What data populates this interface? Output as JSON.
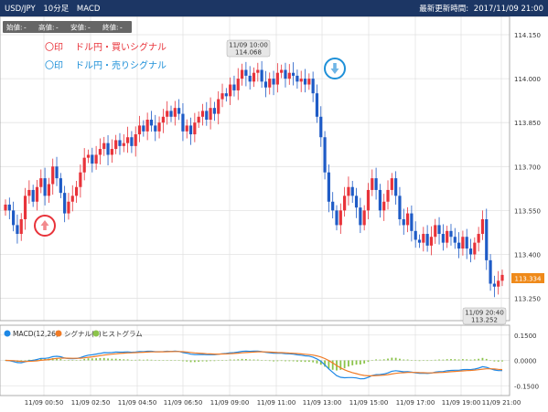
{
  "header": {
    "symbol": "USD/JPY",
    "interval": "10分足",
    "indicator": "MACD",
    "last_updated_label": "最新更新時間:",
    "last_updated_value": "2017/11/09 21:00"
  },
  "ohlc_bar": [
    {
      "label": "始値:",
      "value": "-"
    },
    {
      "label": "高値:",
      "value": "-"
    },
    {
      "label": "安値:",
      "value": "-"
    },
    {
      "label": "終値:",
      "value": "-"
    }
  ],
  "legend": {
    "buy": {
      "symbol": "〇印",
      "text": "ドル円・買いシグナル",
      "color": "#e8333a"
    },
    "sell": {
      "symbol": "〇印",
      "text": "ドル円・売りシグナル",
      "color": "#1e90d8"
    }
  },
  "callouts": {
    "high": {
      "time": "11/09 10:00",
      "price": "114.068"
    },
    "low": {
      "time": "11/09 20:40",
      "price": "113.252"
    }
  },
  "last_price": "113.334",
  "colors": {
    "up": "#e8333a",
    "down": "#1e5bc6",
    "macd": "#1e88e5",
    "signal": "#f07b26",
    "histogram": "#8bc34a",
    "header": "#1c3664"
  },
  "chart_data": [
    {
      "type": "candlestick",
      "title": "USD/JPY 10分足",
      "xlabel": "",
      "ylabel": "",
      "ylim": [
        113.18,
        114.2
      ],
      "y_ticks": [
        "114.150",
        "114.000",
        "113.850",
        "113.700",
        "113.550",
        "113.400",
        "113.250"
      ],
      "x_ticks": [
        "11/09 00:50",
        "11/09 02:50",
        "11/09 04:50",
        "11/09 06:50",
        "11/09 09:00",
        "11/09 11:00",
        "11/09 13:00",
        "11/09 15:00",
        "11/09 17:00",
        "11/09 19:00",
        "11/09 21:00"
      ],
      "close": [
        113.57,
        113.55,
        113.5,
        113.47,
        113.52,
        113.6,
        113.62,
        113.58,
        113.63,
        113.66,
        113.6,
        113.64,
        113.7,
        113.66,
        113.61,
        113.54,
        113.58,
        113.6,
        113.63,
        113.68,
        113.73,
        113.74,
        113.71,
        113.74,
        113.76,
        113.78,
        113.74,
        113.76,
        113.79,
        113.77,
        113.78,
        113.8,
        113.77,
        113.81,
        113.84,
        113.82,
        113.86,
        113.84,
        113.82,
        113.85,
        113.87,
        113.89,
        113.87,
        113.9,
        113.88,
        113.82,
        113.84,
        113.81,
        113.85,
        113.87,
        113.89,
        113.86,
        113.9,
        113.88,
        113.93,
        113.95,
        113.94,
        113.98,
        113.96,
        114.0,
        114.03,
        114.01,
        113.99,
        114.02,
        114.03,
        113.99,
        113.97,
        114.0,
        113.98,
        114.02,
        114.03,
        114.0,
        114.02,
        114.01,
        113.99,
        114.0,
        113.98,
        114.0,
        113.95,
        113.87,
        113.8,
        113.68,
        113.58,
        113.55,
        113.5,
        113.55,
        113.6,
        113.63,
        113.6,
        113.56,
        113.5,
        113.55,
        113.62,
        113.66,
        113.62,
        113.55,
        113.58,
        113.62,
        113.66,
        113.6,
        113.52,
        113.5,
        113.54,
        113.48,
        113.45,
        113.44,
        113.47,
        113.43,
        113.46,
        113.5,
        113.47,
        113.44,
        113.48,
        113.46,
        113.44,
        113.42,
        113.46,
        113.42,
        113.4,
        113.44,
        113.47,
        113.52,
        113.38,
        113.3,
        113.29,
        113.31,
        113.33
      ],
      "y_right_ticks": [
        "0.1500",
        "0.0000",
        "-0.1500"
      ]
    },
    {
      "type": "line",
      "title": "",
      "series": [
        {
          "name": "MACD(12,26)"
        },
        {
          "name": "シグナル(9)"
        },
        {
          "name": "ヒストグラム"
        }
      ],
      "ylim": [
        -0.2,
        0.2
      ],
      "y_ticks": [
        "0.1500",
        "0.0000",
        "-0.1500"
      ]
    }
  ]
}
